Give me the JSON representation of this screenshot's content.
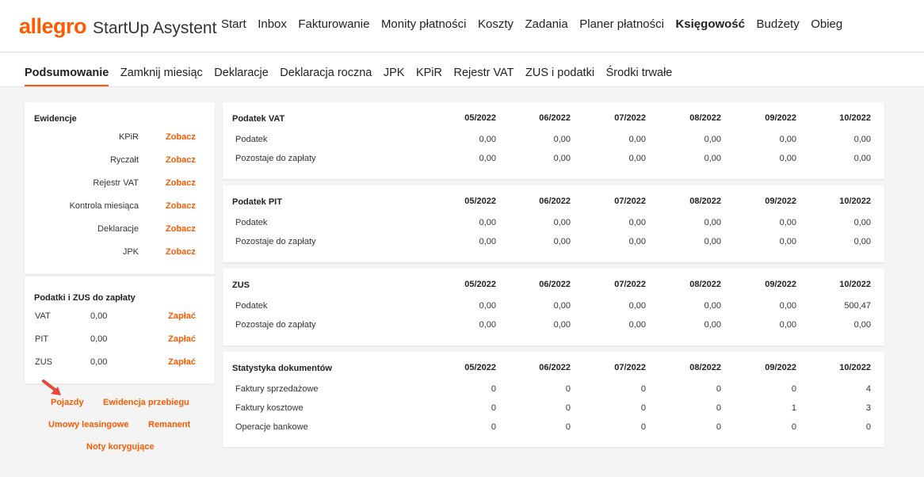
{
  "header": {
    "brand": "allegro",
    "app_name": "StartUp Asystent",
    "nav": [
      {
        "label": "Start",
        "active": false
      },
      {
        "label": "Inbox",
        "active": false
      },
      {
        "label": "Fakturowanie",
        "active": false
      },
      {
        "label": "Monity płatności",
        "active": false
      },
      {
        "label": "Koszty",
        "active": false
      },
      {
        "label": "Zadania",
        "active": false
      },
      {
        "label": "Planer płatności",
        "active": false
      },
      {
        "label": "Księgowość",
        "active": true
      },
      {
        "label": "Budżety",
        "active": false
      },
      {
        "label": "Obieg",
        "active": false
      }
    ]
  },
  "subnav": [
    {
      "label": "Podsumowanie",
      "active": true
    },
    {
      "label": "Zamknij miesiąc",
      "active": false
    },
    {
      "label": "Deklaracje",
      "active": false
    },
    {
      "label": "Deklaracja roczna",
      "active": false
    },
    {
      "label": "JPK",
      "active": false
    },
    {
      "label": "KPiR",
      "active": false
    },
    {
      "label": "Rejestr VAT",
      "active": false
    },
    {
      "label": "ZUS i podatki",
      "active": false
    },
    {
      "label": "Środki trwałe",
      "active": false
    }
  ],
  "ewidencje": {
    "title": "Ewidencje",
    "rows": [
      {
        "label": "KPiR",
        "link": "Zobacz"
      },
      {
        "label": "Ryczałt",
        "link": "Zobacz"
      },
      {
        "label": "Rejestr VAT",
        "link": "Zobacz"
      },
      {
        "label": "Kontrola miesiąca",
        "link": "Zobacz"
      },
      {
        "label": "Deklaracje",
        "link": "Zobacz"
      },
      {
        "label": "JPK",
        "link": "Zobacz"
      }
    ]
  },
  "taxes": {
    "title": "Podatki i ZUS do zapłaty",
    "rows": [
      {
        "name": "VAT",
        "value": "0,00",
        "link": "Zapłać"
      },
      {
        "name": "PIT",
        "value": "0,00",
        "link": "Zapłać"
      },
      {
        "name": "ZUS",
        "value": "0,00",
        "link": "Zapłać"
      }
    ]
  },
  "extra_links": [
    "Pojazdy",
    "Ewidencja przebiegu",
    "Umowy leasingowe",
    "Remanent",
    "Noty korygujące"
  ],
  "months": [
    "05/2022",
    "06/2022",
    "07/2022",
    "08/2022",
    "09/2022",
    "10/2022"
  ],
  "tables": [
    {
      "title": "Podatek VAT",
      "rows": [
        {
          "label": "Podatek",
          "values": [
            "0,00",
            "0,00",
            "0,00",
            "0,00",
            "0,00",
            "0,00"
          ]
        },
        {
          "label": "Pozostaje do zapłaty",
          "values": [
            "0,00",
            "0,00",
            "0,00",
            "0,00",
            "0,00",
            "0,00"
          ]
        }
      ]
    },
    {
      "title": "Podatek PIT",
      "rows": [
        {
          "label": "Podatek",
          "values": [
            "0,00",
            "0,00",
            "0,00",
            "0,00",
            "0,00",
            "0,00"
          ]
        },
        {
          "label": "Pozostaje do zapłaty",
          "values": [
            "0,00",
            "0,00",
            "0,00",
            "0,00",
            "0,00",
            "0,00"
          ]
        }
      ]
    },
    {
      "title": "ZUS",
      "rows": [
        {
          "label": "Podatek",
          "values": [
            "0,00",
            "0,00",
            "0,00",
            "0,00",
            "0,00",
            "500,47"
          ]
        },
        {
          "label": "Pozostaje do zapłaty",
          "values": [
            "0,00",
            "0,00",
            "0,00",
            "0,00",
            "0,00",
            "0,00"
          ]
        }
      ]
    },
    {
      "title": "Statystyka dokumentów",
      "rows": [
        {
          "label": "Faktury sprzedażowe",
          "values": [
            "0",
            "0",
            "0",
            "0",
            "0",
            "4"
          ]
        },
        {
          "label": "Faktury kosztowe",
          "values": [
            "0",
            "0",
            "0",
            "0",
            "1",
            "3"
          ]
        },
        {
          "label": "Operacje bankowe",
          "values": [
            "0",
            "0",
            "0",
            "0",
            "0",
            "0"
          ]
        }
      ]
    }
  ],
  "colors": {
    "accent": "#ff5a00",
    "annotation_arrow": "#e8453c"
  }
}
